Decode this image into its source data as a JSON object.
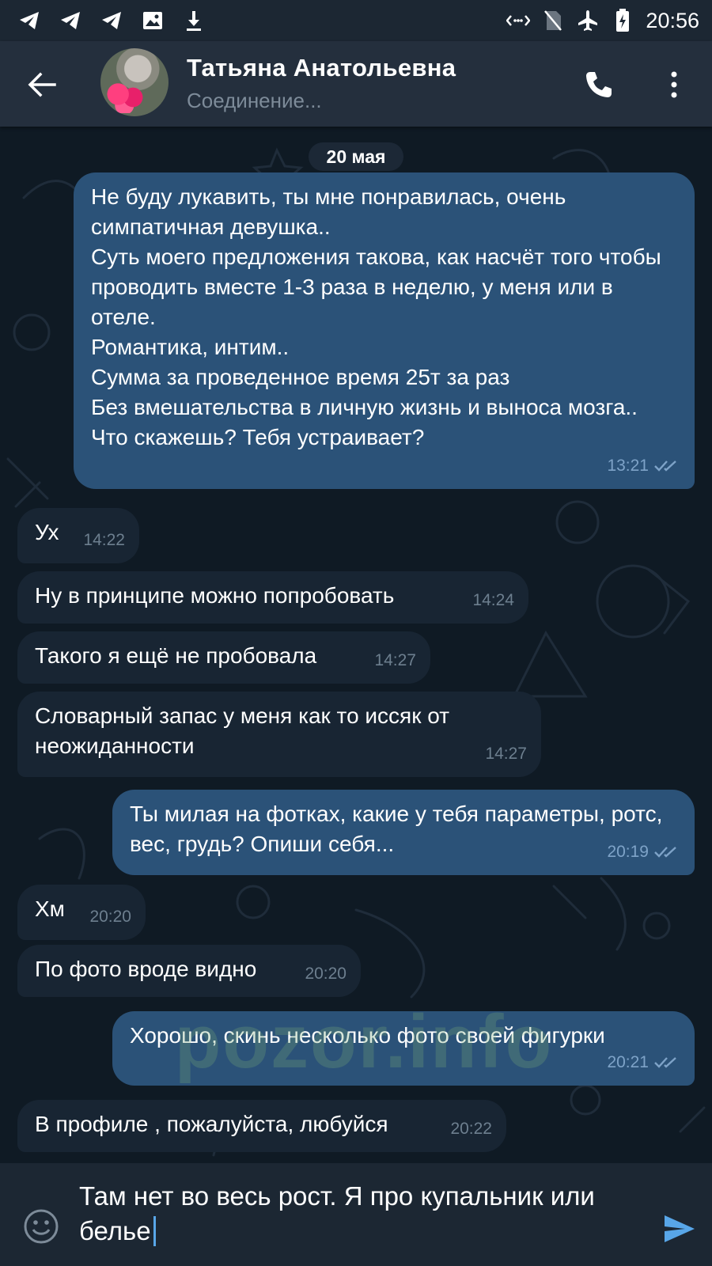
{
  "status_bar": {
    "time": "20:56",
    "left_icons": [
      "telegram-icon",
      "telegram-icon",
      "telegram-icon",
      "image-icon",
      "download-icon"
    ],
    "right_icons": [
      "data-saver-icon",
      "no-sim-icon",
      "airplane-icon",
      "battery-charging-icon"
    ]
  },
  "header": {
    "contact_name": "Татьяна Анатольевна",
    "status": "Соединение..."
  },
  "chat": {
    "date": "20 мая",
    "messages": [
      {
        "direction": "out",
        "text": "Не буду лукавить, ты мне понравилась, очень симпатичная девушка..\nСуть моего предложения такова, как насчёт того чтобы проводить вместе 1-3 раза в неделю, у меня или в отеле.\nРомантика, интим..\nСумма за проведенное время 25т за раз\nБез вмешательства в личную жизнь и выноса мозга..\nЧто скажешь? Тебя устраивает?",
        "time": "13:21",
        "read": true
      },
      {
        "direction": "in",
        "text": "Ух",
        "time": "14:22"
      },
      {
        "direction": "in",
        "text": "Ну в принципе можно попробовать",
        "time": "14:24"
      },
      {
        "direction": "in",
        "text": "Такого я ещё не пробовала",
        "time": "14:27"
      },
      {
        "direction": "in",
        "text": "Словарный запас у меня как то иссяк от неожиданности",
        "time": "14:27"
      },
      {
        "direction": "out",
        "text": "Ты милая на фотках, какие у тебя параметры, ротс, вес, грудь? Опиши себя...",
        "time": "20:19",
        "read": true
      },
      {
        "direction": "in",
        "text": "Хм",
        "time": "20:20"
      },
      {
        "direction": "in",
        "text": "По фото вроде видно",
        "time": "20:20"
      },
      {
        "direction": "out",
        "text": "Хорошо, скинь несколько фото своей фигурки",
        "time": "20:21",
        "read": true
      },
      {
        "direction": "in",
        "text": "В профиле , пожалуйста, любуйся",
        "time": "20:22"
      }
    ],
    "watermark": "pozor.info"
  },
  "input": {
    "value": "Там нет во весь рост. Я про купальник или белье"
  },
  "colors": {
    "background": "#0e1621",
    "header": "#242f3d",
    "incoming_bubble": "#182533",
    "outgoing_bubble": "#2b5278",
    "accent": "#58a6e8"
  }
}
